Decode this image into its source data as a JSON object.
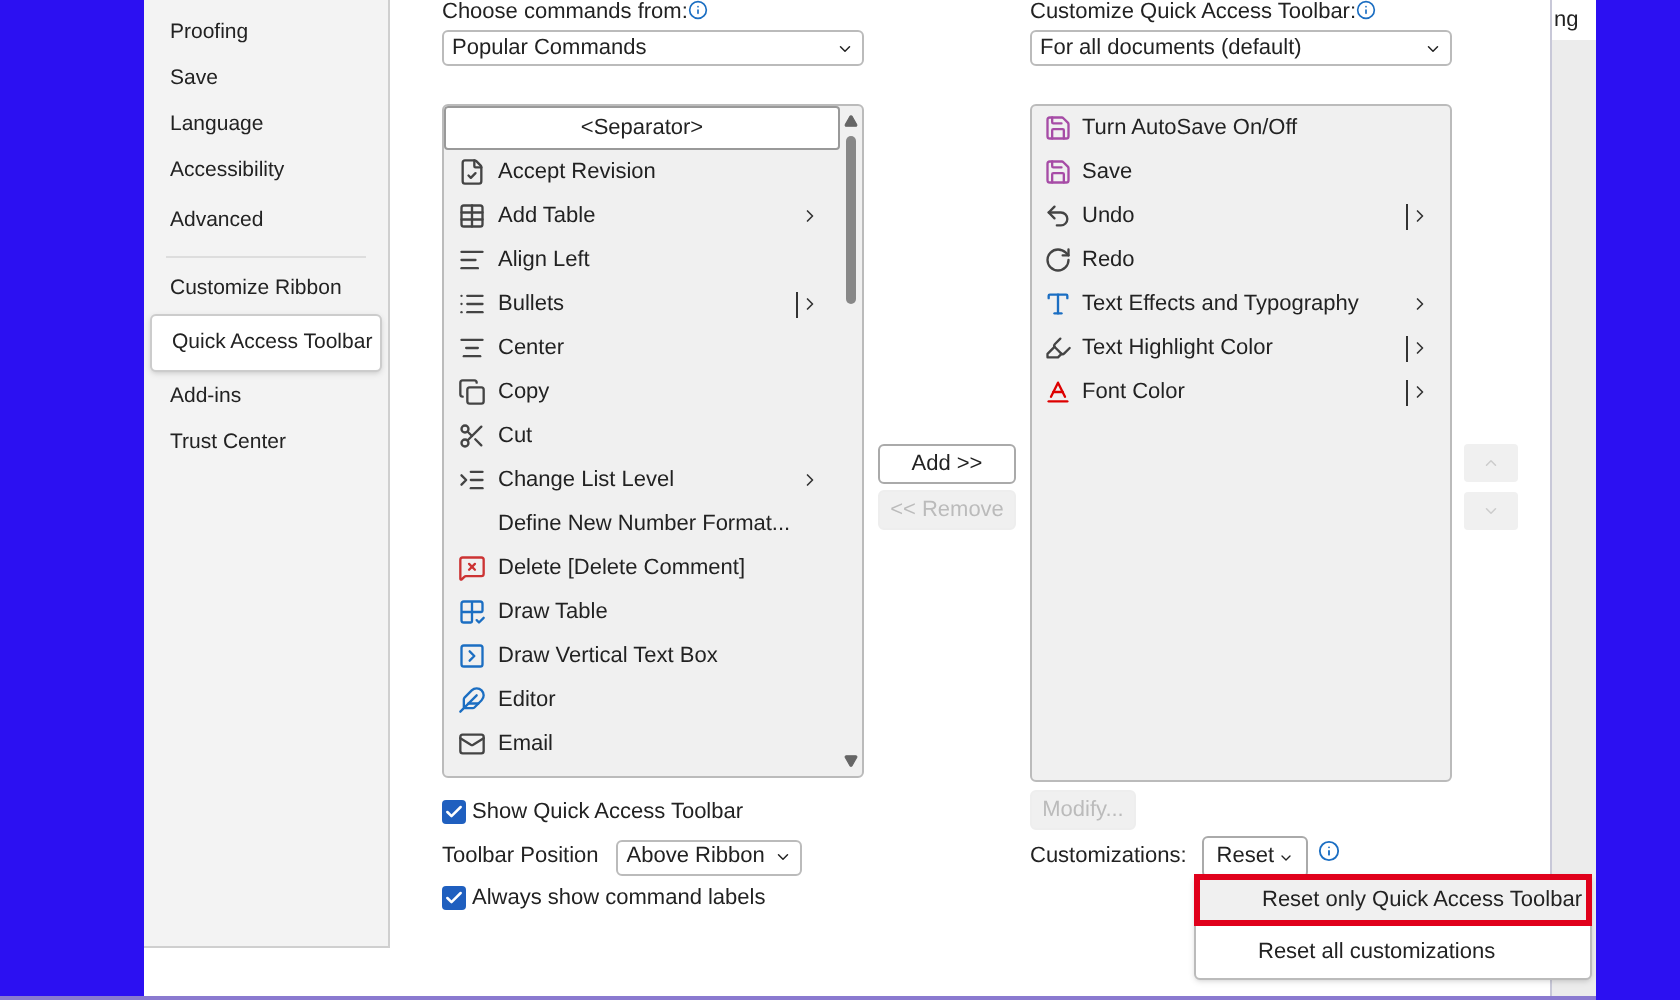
{
  "sidebar": {
    "items": [
      {
        "label": "Proofing",
        "selected": false
      },
      {
        "label": "Save",
        "selected": false
      },
      {
        "label": "Language",
        "selected": false
      },
      {
        "label": "Accessibility",
        "selected": false
      },
      {
        "label": "Advanced",
        "selected": false
      },
      {
        "label": "Customize Ribbon",
        "selected": false
      },
      {
        "label": "Quick Access Toolbar",
        "selected": true
      },
      {
        "label": "Add-ins",
        "selected": false
      },
      {
        "label": "Trust Center",
        "selected": false
      }
    ]
  },
  "commands_from": {
    "label": "Choose commands from:",
    "value": "Popular Commands"
  },
  "commands": [
    {
      "label": "<Separator>",
      "selected": true
    },
    {
      "label": "Accept Revision",
      "selected": false
    },
    {
      "label": "Add Table",
      "selected": false,
      "kind": "submenu"
    },
    {
      "label": "Align Left",
      "selected": false
    },
    {
      "label": "Bullets",
      "selected": false,
      "kind": "split"
    },
    {
      "label": "Center",
      "selected": false
    },
    {
      "label": "Copy",
      "selected": false
    },
    {
      "label": "Cut",
      "selected": false
    },
    {
      "label": "Change List Level",
      "selected": false,
      "kind": "submenu"
    },
    {
      "label": "Define New Number Format...",
      "selected": false
    },
    {
      "label": "Delete [Delete Comment]",
      "selected": false
    },
    {
      "label": "Draw Table",
      "selected": false
    },
    {
      "label": "Draw Vertical Text Box",
      "selected": false
    },
    {
      "label": "Editor",
      "selected": false
    },
    {
      "label": "Email",
      "selected": false
    }
  ],
  "add_button": {
    "label": "Add >>",
    "disabled": false
  },
  "remove_button": {
    "label": "<< Remove",
    "disabled": true
  },
  "customize_toolbar": {
    "label": "Customize Quick Access Toolbar:",
    "value": "For all documents (default)"
  },
  "toolbar_items": [
    {
      "label": "Turn AutoSave On/Off"
    },
    {
      "label": "Save"
    },
    {
      "label": "Undo",
      "kind": "split"
    },
    {
      "label": "Redo"
    },
    {
      "label": "Text Effects and Typography",
      "kind": "submenu"
    },
    {
      "label": "Text Highlight Color",
      "kind": "split"
    },
    {
      "label": "Font Color",
      "kind": "split"
    }
  ],
  "move_up": {
    "disabled": true
  },
  "move_down": {
    "disabled": true
  },
  "modify_button": {
    "label": "Modify...",
    "disabled": true
  },
  "show_toolbar": {
    "label": "Show Quick Access Toolbar",
    "checked": true
  },
  "toolbar_position": {
    "label": "Toolbar Position",
    "value": "Above Ribbon"
  },
  "always_labels": {
    "label": "Always show command labels",
    "checked": true
  },
  "customizations": {
    "label": "Customizations:",
    "button": "Reset"
  },
  "reset_menu": [
    {
      "label": "Reset only Quick Access Toolbar",
      "selected": true
    },
    {
      "label": "Reset all customizations",
      "selected": false
    }
  ],
  "background_window": {
    "text": "ng"
  }
}
